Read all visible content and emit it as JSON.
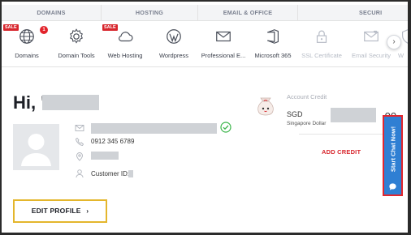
{
  "categories": [
    {
      "label": "DOMAINS"
    },
    {
      "label": "HOSTING"
    },
    {
      "label": "EMAIL & OFFICE"
    },
    {
      "label": "SECURI"
    }
  ],
  "tiles": [
    {
      "label": "Domains",
      "icon": "globe-icon",
      "sale": "SALE",
      "badge": "1"
    },
    {
      "label": "Domain Tools",
      "icon": "gear-icon"
    },
    {
      "label": "Web Hosting",
      "icon": "cloud-icon",
      "sale": "SALE"
    },
    {
      "label": "Wordpress",
      "icon": "wordpress-icon"
    },
    {
      "label": "Professional E...",
      "icon": "envelope-icon"
    },
    {
      "label": "Microsoft 365",
      "icon": "office-icon"
    },
    {
      "label": "SSL Certificate",
      "icon": "lock-icon"
    },
    {
      "label": "Email Security",
      "icon": "mail-heart-icon"
    },
    {
      "label": "W",
      "icon": "shield-icon"
    }
  ],
  "next_label": "›",
  "greeting": "Hi, '",
  "profile": {
    "phone": "0912 345 6789",
    "customer_id_label": "Customer ID: "
  },
  "credit": {
    "title": "Account Credit",
    "currency": "SGD",
    "currency_name": "Singapore Dollar",
    "amount_suffix": ".00",
    "add_label": "ADD CREDIT"
  },
  "edit_profile_label": "EDIT PROFILE",
  "chat_label": "Start Chat Now!",
  "colors": {
    "accent_red": "#d8262d",
    "chat_blue": "#2f7fd3",
    "edit_border": "#e4b62c",
    "verified_green": "#3bb54a"
  }
}
